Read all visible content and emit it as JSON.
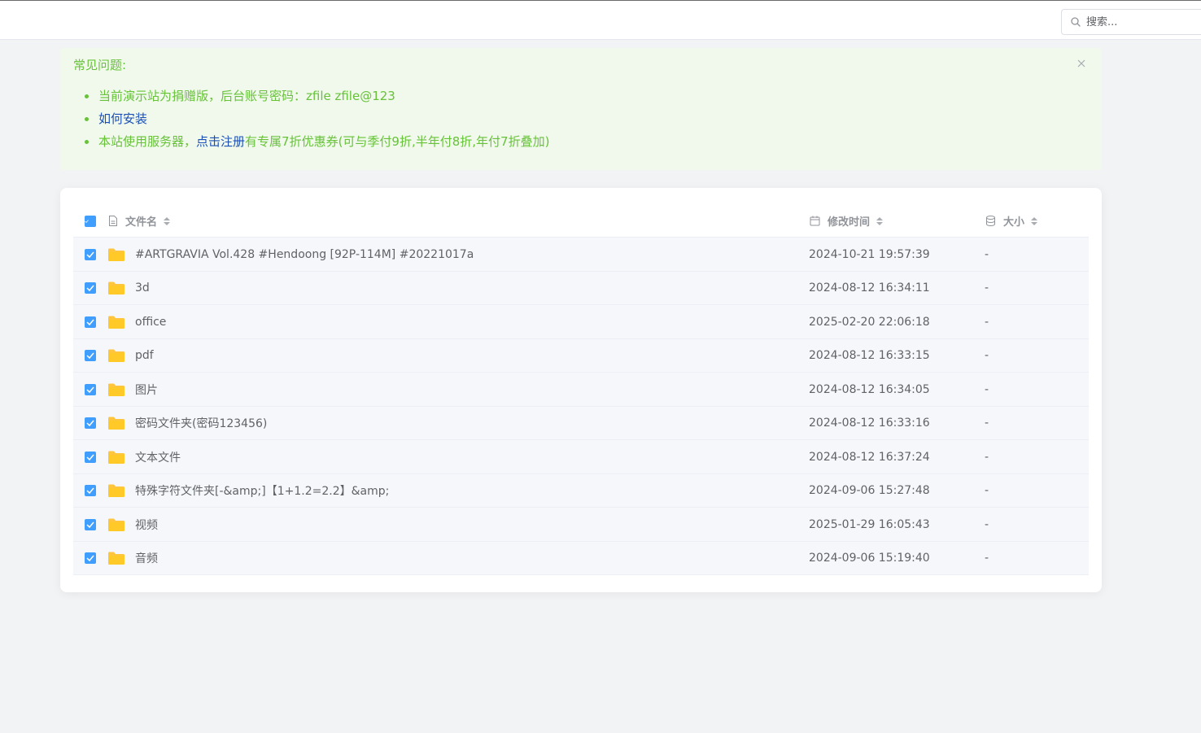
{
  "search": {
    "placeholder": "搜索..."
  },
  "notice": {
    "title": "常见问题:",
    "items": [
      {
        "text": "当前演示站为捐赠版，后台账号密码：zfile zfile@123"
      },
      {
        "link": "如何安装"
      },
      {
        "prefix": "本站使用服务器，",
        "link": "点击注册",
        "suffix": "有专属7折优惠券(可与季付9折,半年付8折,年付7折叠加)"
      }
    ]
  },
  "table": {
    "headers": {
      "name": "文件名",
      "time": "修改时间",
      "size": "大小"
    },
    "rows": [
      {
        "name": "#ARTGRAVIA Vol.428 #Hendoong [92P-114M] #20221017a",
        "time": "2024-10-21 19:57:39",
        "size": "-"
      },
      {
        "name": "3d",
        "time": "2024-08-12 16:34:11",
        "size": "-"
      },
      {
        "name": "office",
        "time": "2025-02-20 22:06:18",
        "size": "-"
      },
      {
        "name": "pdf",
        "time": "2024-08-12 16:33:15",
        "size": "-"
      },
      {
        "name": "图片",
        "time": "2024-08-12 16:34:05",
        "size": "-"
      },
      {
        "name": "密码文件夹(密码123456)",
        "time": "2024-08-12 16:33:16",
        "size": "-"
      },
      {
        "name": "文本文件",
        "time": "2024-08-12 16:37:24",
        "size": "-"
      },
      {
        "name": "特殊字符文件夹[-&amp;]【1+1.2=2.2】&amp;",
        "time": "2024-09-06 15:27:48",
        "size": "-"
      },
      {
        "name": "视频",
        "time": "2025-01-29 16:05:43",
        "size": "-"
      },
      {
        "name": "音频",
        "time": "2024-09-06 15:19:40",
        "size": "-"
      }
    ]
  },
  "colors": {
    "accent": "#409eff",
    "notice_text": "#67c23a",
    "notice_bg": "#f0f9eb",
    "link": "#1a4fb8",
    "folder": "#ffc53d"
  },
  "icons": {
    "search": "search-icon",
    "close": "close-icon",
    "folder": "folder-icon",
    "file": "file-icon",
    "calendar": "calendar-icon",
    "database": "database-icon",
    "sort": "sort-icon",
    "check": "check-icon"
  }
}
